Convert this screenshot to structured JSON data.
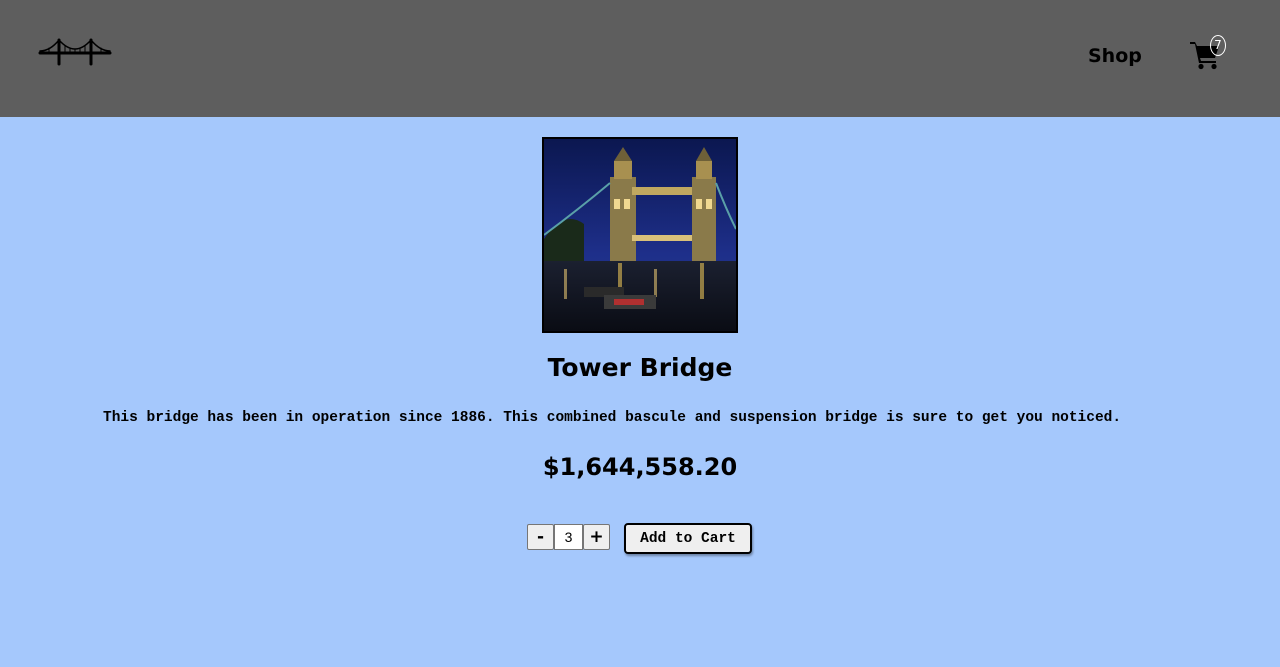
{
  "colors": {
    "navbar_bg": "#5e5e5e",
    "page_bg": "#a5c8fc",
    "badge": "#ffffff"
  },
  "nav": {
    "logo_icon": "bridge-logo-icon",
    "shop_label": "Shop",
    "cart_icon": "shopping-cart-icon",
    "cart_count": "7"
  },
  "product": {
    "image_alt": "Tower Bridge",
    "title": "Tower Bridge",
    "description": "This bridge has been in operation since 1886. This combined bascule and suspension bridge is sure to get you noticed.",
    "price": "$1,644,558.20"
  },
  "quantity": {
    "decrement_label": "-",
    "value": "3",
    "increment_label": "+"
  },
  "add_to_cart_label": "Add to Cart"
}
